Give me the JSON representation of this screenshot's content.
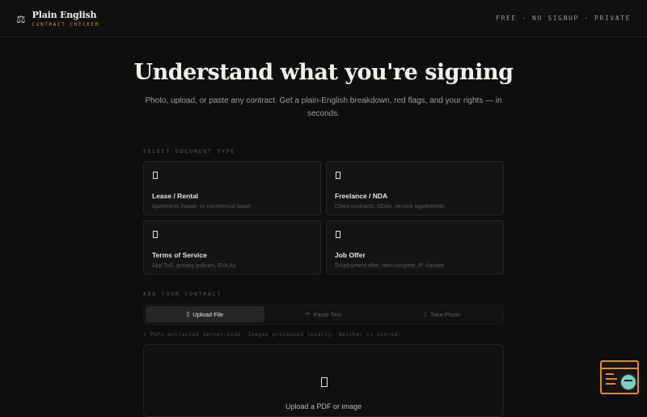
{
  "header": {
    "brand_name": "Plain English",
    "brand_sub": "CONTRACT CHECKER",
    "brand_icon": "scales-icon",
    "tagline": "FREE · NO SIGNUP · PRIVATE"
  },
  "hero": {
    "title": "Understand what you're signing",
    "subtitle": "Photo, upload, or paste any contract. Get a plain-English breakdown, red flags, and your rights — in seconds."
  },
  "document_types": {
    "label": "SELECT DOCUMENT TYPE",
    "items": [
      {
        "title": "Lease / Rental",
        "desc": "Apartment, house, or commercial lease",
        "icon": "document-icon"
      },
      {
        "title": "Freelance / NDA",
        "desc": "Client contracts, NDAs, service agreements",
        "icon": "document-icon"
      },
      {
        "title": "Terms of Service",
        "desc": "App ToS, privacy policies, EULAs",
        "icon": "document-icon"
      },
      {
        "title": "Job Offer",
        "desc": "Employment offer, non-compete, IP clauses",
        "icon": "document-icon"
      }
    ]
  },
  "add_contract": {
    "label": "ADD YOUR CONTRACT",
    "tabs": [
      {
        "label": "Upload File",
        "glyph": "▯",
        "active": true
      },
      {
        "label": "Paste Text",
        "glyph": "✏",
        "active": false
      },
      {
        "label": "Take Photo",
        "glyph": "▯",
        "active": false
      }
    ],
    "note": "▯ PDFs extracted server-side. Images processed locally. Neither is stored.",
    "dropzone_text": "Upload a PDF or image"
  },
  "colors": {
    "accent": "#d98a3a",
    "background": "#0e0e0e",
    "card": "#141414"
  }
}
